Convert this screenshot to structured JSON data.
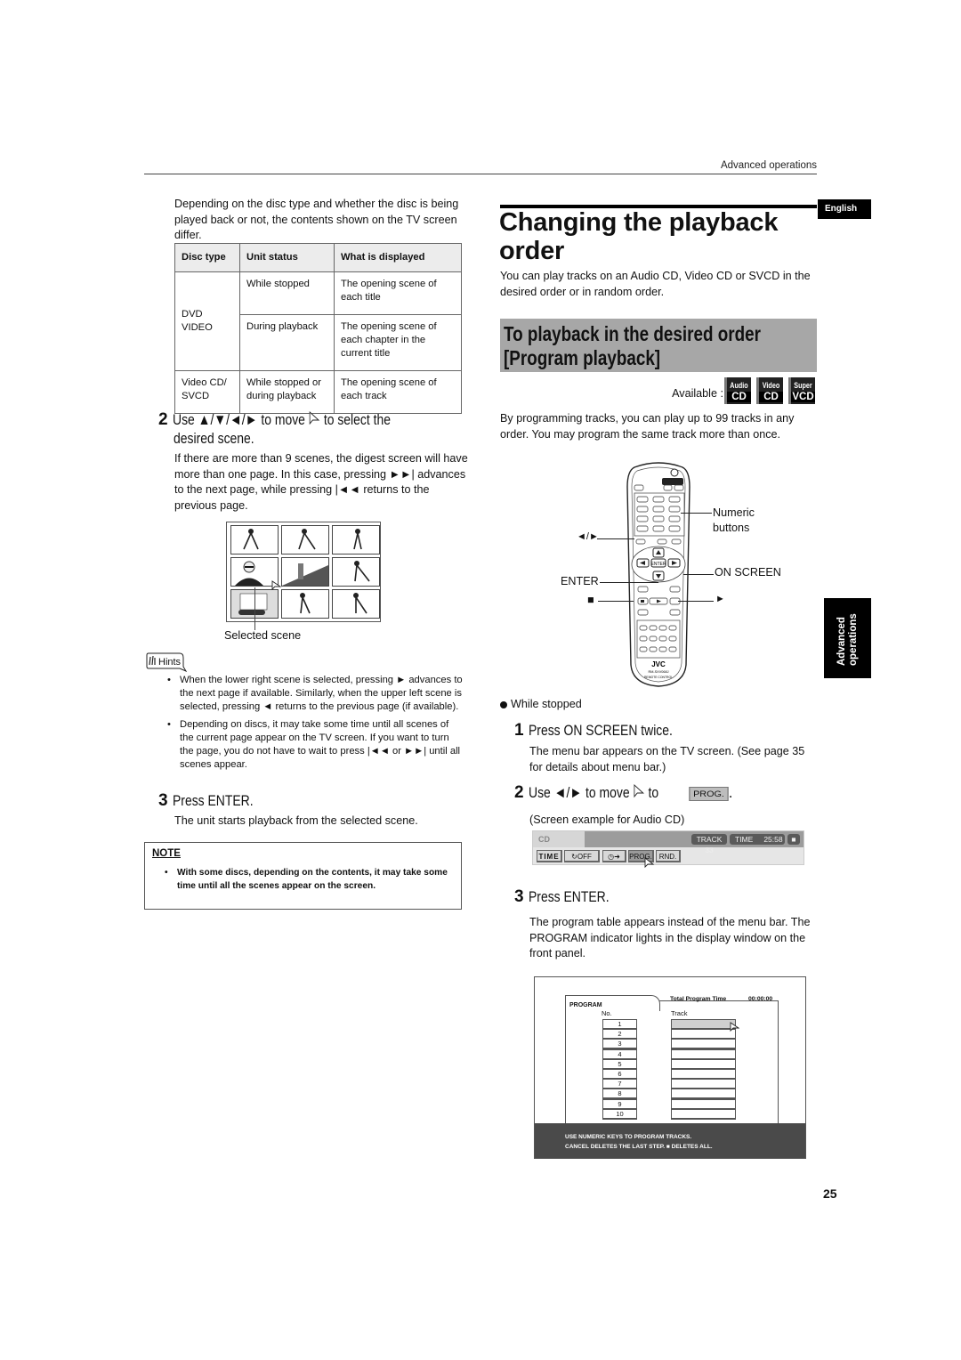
{
  "header": {
    "section": "Advanced operations",
    "language_badge": "English",
    "side_tab": [
      "Advanced",
      "operations"
    ],
    "page_number": "25"
  },
  "left": {
    "intro": "Depending on the disc type and whether the disc is being played back or not, the contents shown on the TV screen differ.",
    "table": {
      "headers": [
        "Disc type",
        "Unit status",
        "What is displayed"
      ],
      "rows": [
        {
          "disc": "DVD VIDEO",
          "status": "While stopped",
          "display": "The opening scene of each title"
        },
        {
          "disc": "",
          "status": "During playback",
          "display": "The opening scene of each chapter in the current title"
        },
        {
          "disc": "Video CD/ SVCD",
          "status": "While stopped or during playback",
          "display": "The opening scene of each track"
        }
      ]
    },
    "step2": {
      "number": "2",
      "text": "Use ▲/▼/◄/► to move ☞ to select the desired scene.",
      "line1": "Use ▲/▼/◄/► to move",
      "line1b": "to select the",
      "line2": "desired scene.",
      "desc": "If there are more than 9 scenes, the digest screen will have more than one page. In this case, pressing ►►| advances to the next page, while pressing |◄◄ returns to the previous page."
    },
    "scene_grid": {
      "selected_label": "Selected scene",
      "scenes": [
        "runner",
        "soccer players",
        "couple",
        "man in sunglasses",
        "street scene",
        "beach",
        "building and car",
        "trumpet player",
        "waving person"
      ],
      "selected_index": 3
    },
    "hints": {
      "label": "Hints",
      "items": [
        "When the lower right scene is selected, pressing ► advances to the next page if available. Similarly, when the upper left scene is selected, pressing ◄ returns to the previous page (if available).",
        "Depending on discs, it may take some time until all scenes of the current page appear on the TV screen. If you want to turn the page, you do not have to wait to press |◄◄ or ►►| until all scenes appear."
      ]
    },
    "step3": {
      "number": "3",
      "text": "Press ENTER.",
      "desc": "The unit starts playback from the selected scene."
    },
    "note": {
      "title": "NOTE",
      "items": [
        "With some discs, depending on the contents, it may take some time until all the scenes appear on the screen."
      ]
    }
  },
  "right": {
    "title": "Changing the playback order",
    "title_desc": "You can play tracks on an Audio CD, Video CD or SVCD in the desired order or in random order.",
    "subtitle_line1": "To playback in the desired order",
    "subtitle_line2": "[Program playback]",
    "available_label": "Available :",
    "disc_logos": [
      {
        "top": "Audio",
        "bottom": "CD"
      },
      {
        "top": "Video",
        "bottom": "CD"
      },
      {
        "top": "Super",
        "bottom": "VCD"
      }
    ],
    "prog_desc": "By programming tracks, you can play up to 99 tracks in any order. You may program the same track more than once.",
    "remote": {
      "brand": "JVC",
      "model": "RM-SXV068J",
      "caption": "REMOTE CONTROL",
      "callouts": {
        "numeric": "Numeric",
        "numeric2": "buttons",
        "arrows": "◄/►",
        "on_screen": "ON SCREEN",
        "enter": "ENTER",
        "stop": "■",
        "play": "►"
      }
    },
    "condition": "While stopped",
    "step1": {
      "number": "1",
      "text": "Press ON SCREEN twice.",
      "desc": "The menu bar appears on the TV screen. (See page 35 for details about menu bar.)"
    },
    "step2": {
      "number": "2",
      "text_a": "Use ◄/► to move",
      "text_b": "to",
      "chip": "PROG.",
      "text_c": "."
    },
    "screen_example": "(Screen example for Audio CD)",
    "menubar": {
      "disc": "CD",
      "track": "TRACK 33",
      "time_label": "TIME",
      "time_value": "25:58",
      "stop_icon": "■",
      "buttons": [
        "TIME",
        "OFF",
        "",
        "PROG.",
        "RND."
      ]
    },
    "step3": {
      "number": "3",
      "text": "Press ENTER.",
      "desc": "The program table appears instead of the menu bar. The PROGRAM indicator lights in the display window on the front panel."
    },
    "program_screen": {
      "tab": "PROGRAM",
      "total_label": "Total Program Time",
      "total_value": "00:00:00",
      "col_no": "No.",
      "col_track": "Track",
      "rows": [
        "1",
        "2",
        "3",
        "4",
        "5",
        "6",
        "7",
        "8",
        "9",
        "10"
      ],
      "footer1": "USE NUMERIC KEYS  TO PROGRAM TRACKS.",
      "footer2": "CANCEL DELETES THE LAST STEP. ■ DELETES ALL."
    }
  }
}
